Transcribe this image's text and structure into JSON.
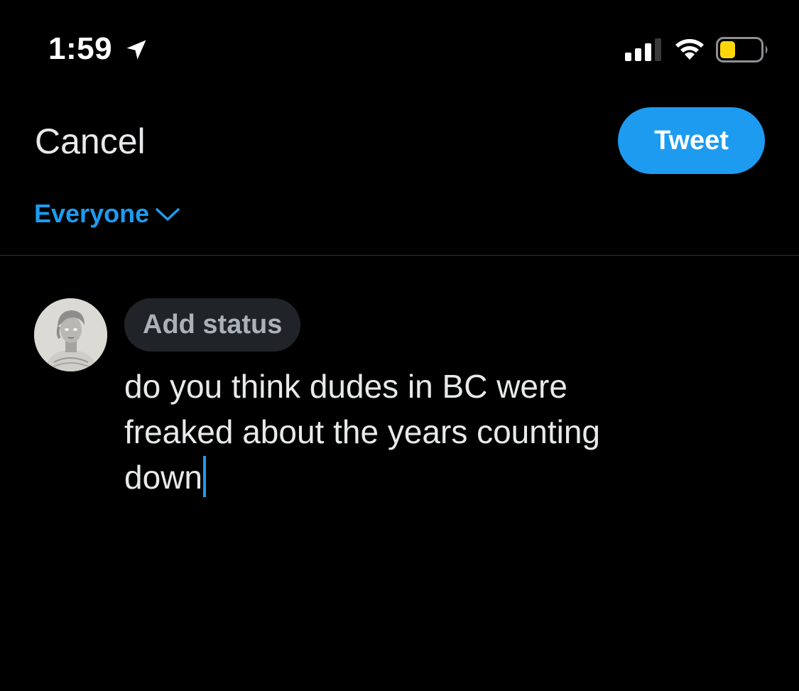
{
  "status_bar": {
    "time": "1:59",
    "icons": [
      "location-arrow-icon",
      "cellular-signal-icon",
      "wifi-icon",
      "battery-low-icon"
    ]
  },
  "header": {
    "cancel_label": "Cancel",
    "tweet_label": "Tweet"
  },
  "audience": {
    "label": "Everyone",
    "icon": "chevron-down-icon"
  },
  "composer": {
    "add_status_label": "Add status",
    "text": "do you think dudes in BC were\nfreaked about the years counting\ndown"
  },
  "colors": {
    "background": "#000000",
    "accent": "#1d9bf0",
    "text": "#e7e9ea",
    "pill_bg": "#202327",
    "battery_low": "#ffd60a"
  }
}
